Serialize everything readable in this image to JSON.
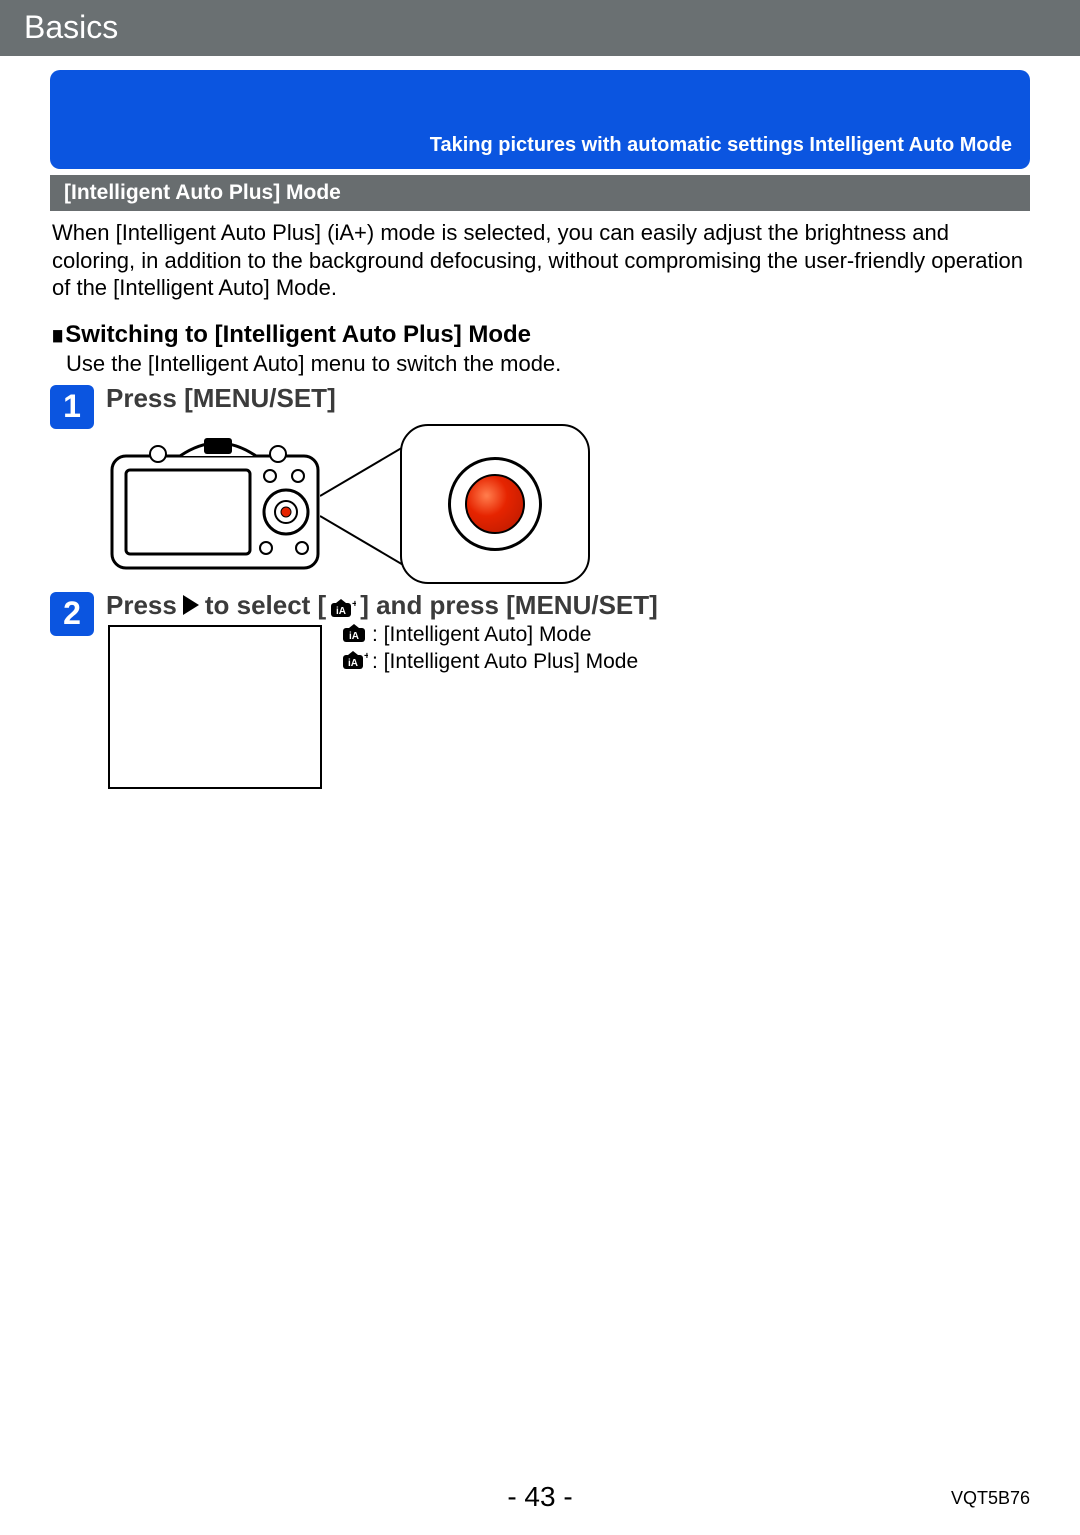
{
  "header": {
    "title": "Basics"
  },
  "banner": {
    "text": "Taking pictures with automatic settings  Intelligent Auto Mode"
  },
  "subheader": {
    "title": "[Intelligent Auto Plus] Mode"
  },
  "intro": "When [Intelligent Auto Plus] (iA+) mode is selected, you can easily adjust the brightness and coloring, in addition to the background defocusing, without compromising the user-friendly operation of the [Intelligent Auto] Mode.",
  "switching": {
    "heading": "Switching to [Intelligent Auto Plus] Mode",
    "note": "Use the [Intelligent Auto] menu to switch the mode."
  },
  "steps": {
    "one": {
      "num": "1",
      "title": "Press [MENU/SET]"
    },
    "two": {
      "num": "2",
      "title_pre": "Press",
      "title_mid": "to select [",
      "title_post": "] and press [MENU/SET]"
    }
  },
  "modes": {
    "ia": ": [Intelligent Auto] Mode",
    "iap": ": [Intelligent Auto Plus] Mode"
  },
  "footer": {
    "page": "- 43 -",
    "code": "VQT5B76"
  }
}
